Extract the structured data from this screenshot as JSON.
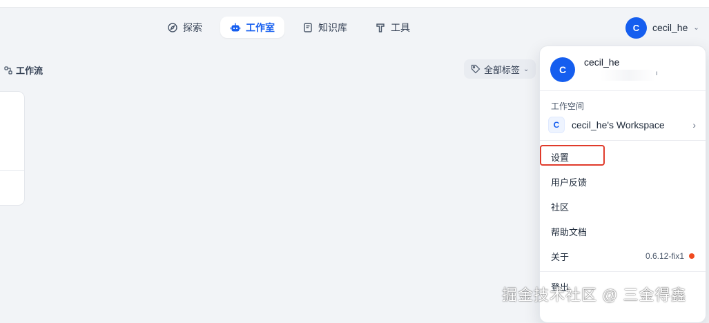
{
  "nav": {
    "items": [
      {
        "label": "探索",
        "icon": "compass-icon",
        "active": false
      },
      {
        "label": "工作室",
        "icon": "robot-icon",
        "active": true
      },
      {
        "label": "知识库",
        "icon": "book-icon",
        "active": false
      },
      {
        "label": "工具",
        "icon": "hammer-icon",
        "active": false
      }
    ]
  },
  "account": {
    "avatar_letter": "C",
    "username": "cecil_he",
    "chevron": "⌄"
  },
  "section": {
    "title": "工作流"
  },
  "tag_filter": {
    "label": "全部标签",
    "chevron": "⌄"
  },
  "menu": {
    "avatar_letter": "C",
    "name": "cecil_he",
    "email_mark": "ı",
    "workspace_label": "工作空间",
    "workspace_badge": "C",
    "workspace_name": "cecil_he's Workspace",
    "workspace_chevron": "›",
    "items": {
      "settings": "设置",
      "feedback": "用户反馈",
      "community": "社区",
      "docs": "帮助文档",
      "about": "关于",
      "logout": "登出"
    },
    "version": "0.6.12-fix1"
  },
  "watermark": "掘金技术社区 @ 三金得鑫",
  "colors": {
    "accent": "#155eef",
    "highlight": "#e03a2a",
    "version_dot": "#f04a1f"
  }
}
